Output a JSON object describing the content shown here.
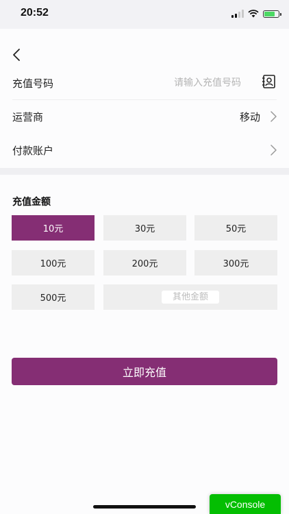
{
  "status_bar": {
    "time": "20:52"
  },
  "form": {
    "phone_label": "充值号码",
    "phone_placeholder": "请输入充值号码",
    "carrier_label": "运营商",
    "carrier_value": "移动",
    "payment_label": "付款账户"
  },
  "amounts": {
    "title": "充值金额",
    "options": [
      "10元",
      "30元",
      "50元",
      "100元",
      "200元",
      "300元",
      "500元"
    ],
    "selected": "10元",
    "other_placeholder": "其他金额"
  },
  "submit_label": "立即充值",
  "vconsole_label": "vConsole",
  "colors": {
    "accent": "#852e74",
    "vconsole": "#04be02"
  },
  "icons": {
    "back": "chevron-left-icon",
    "contacts": "contact-book-icon",
    "chevron": "chevron-right-icon"
  }
}
